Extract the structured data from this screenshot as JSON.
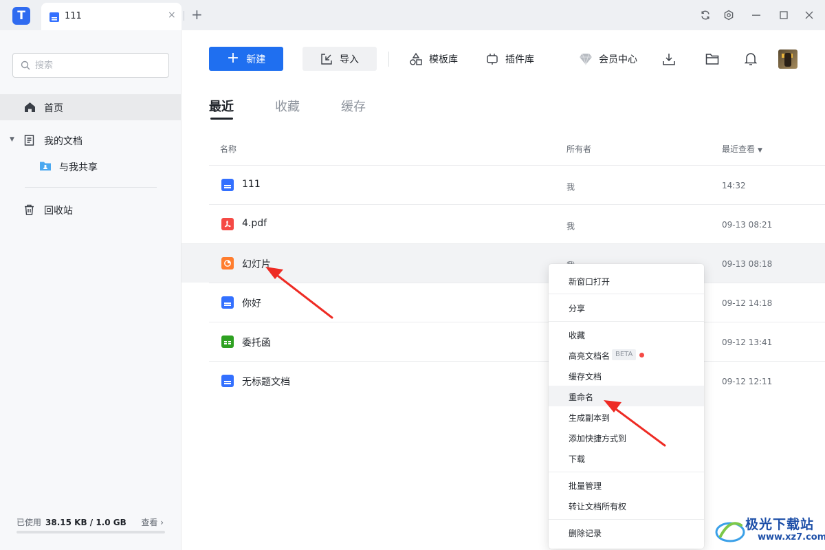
{
  "titlebar": {
    "logo_glyph": "T",
    "tab_label": "111",
    "tab_close": "×",
    "tab_add": "+",
    "controls": [
      "sync-icon",
      "gear-icon",
      "minimize-icon",
      "maximize-icon",
      "close-icon"
    ]
  },
  "sidebar": {
    "search_placeholder": "搜索",
    "items": [
      {
        "label": "首页",
        "icon": "home-icon"
      },
      {
        "label": "我的文档",
        "icon": "document-icon"
      },
      {
        "label": "与我共享",
        "icon": "shared-folder-icon"
      },
      {
        "label": "回收站",
        "icon": "trash-icon"
      }
    ],
    "storage": {
      "label": "已使用",
      "value": "38.15 KB / 1.0 GB",
      "view": "查看 ›",
      "fraction": 4e-05
    }
  },
  "toolbar": {
    "new": "新建",
    "import": "导入",
    "templates": "模板库",
    "plugins": "插件库",
    "member": "会员中心"
  },
  "tabs": [
    "最近",
    "收藏",
    "缓存"
  ],
  "table": {
    "headers": {
      "name": "名称",
      "owner": "所有者",
      "recent": "最近查看"
    },
    "rows": [
      {
        "name": "111",
        "type": "doc",
        "owner": "我",
        "time": "14:32"
      },
      {
        "name": "4.pdf",
        "type": "pdf",
        "owner": "我",
        "time": "09-13 08:21"
      },
      {
        "name": "幻灯片",
        "type": "ppt",
        "owner": "我",
        "time": "09-13 08:18"
      },
      {
        "name": "你好",
        "type": "doc",
        "owner": "",
        "time": "09-12 14:18"
      },
      {
        "name": "委托函",
        "type": "sheet",
        "owner": "",
        "time": "09-12 13:41"
      },
      {
        "name": "无标题文档",
        "type": "doc",
        "owner": "",
        "time": "09-12 12:11"
      }
    ]
  },
  "context_menu": {
    "items": [
      "新窗口打开",
      "分享",
      "收藏",
      "高亮文档名",
      "缓存文档",
      "重命名",
      "生成副本到",
      "添加快捷方式到",
      "下载",
      "批量管理",
      "转让文档所有权",
      "删除记录"
    ],
    "beta": "BETA"
  },
  "watermark": {
    "name": "极光下载站",
    "url": "www.xz7.com"
  },
  "colors": {
    "primary": "#1f6ff0",
    "annotation": "#ee2b24",
    "sidebar_bg": "#f7f8fa"
  }
}
